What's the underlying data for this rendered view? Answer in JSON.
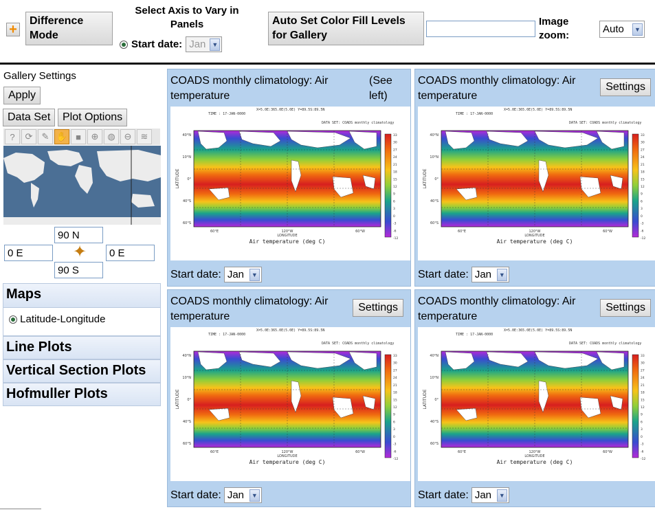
{
  "toolbar": {
    "plus_icon": "plus-icon",
    "difference_mode": "Difference Mode",
    "axis_title": "Select Axis to Vary in Panels",
    "start_date_label": "Start date:",
    "start_date_value": "Jan",
    "auto_set_label": "Auto Set Color Fill Levels for Gallery",
    "auto_set_value": "",
    "image_zoom_label": "Image zoom:",
    "image_zoom_value": "Auto"
  },
  "sidebar": {
    "gallery_settings": "Gallery Settings",
    "apply": "Apply",
    "tabs": [
      "Data Set",
      "Plot Options"
    ],
    "tools": [
      "help-icon",
      "reset-icon",
      "pencil-icon",
      "hand-icon",
      "square-icon",
      "zoom-in-icon",
      "globe-icon",
      "zoom-out-icon",
      "layers-icon"
    ],
    "coords": {
      "north": "90 N",
      "south": "90 S",
      "west": "0 E",
      "east": "0 E"
    },
    "sections": {
      "maps": "Maps",
      "maps_option": "Latitude-Longitude",
      "line_plots": "Line Plots",
      "vertical_section_plots": "Vertical Section Plots",
      "hofmuller_plots": "Hofmuller Plots"
    }
  },
  "panels": [
    {
      "title": "COADS monthly climatology: Air temperature",
      "note": "(See left)",
      "settings": "",
      "date_label": "Start date:",
      "date_value": "Jan"
    },
    {
      "title": "COADS monthly climatology: Air temperature",
      "note": "",
      "settings": "Settings",
      "date_label": "Start date:",
      "date_value": "Jan"
    },
    {
      "title": "COADS monthly climatology: Air temperature",
      "note": "",
      "settings": "Settings",
      "date_label": "Start date:",
      "date_value": "Jan"
    },
    {
      "title": "COADS monthly climatology: Air temperature",
      "note": "",
      "settings": "Settings",
      "date_label": "Start date:",
      "date_value": "Jan"
    }
  ],
  "plot": {
    "header_left": "TIME : 17-JAN-0000",
    "header_center": "X=5.0E:365.0E(5.0E)  Y=89.5S:89.5N",
    "header_right": "DATA SET: COADS monthly climatology",
    "xlabel": "Air temperature (deg C)",
    "ylabel": "LATITUDE",
    "x_axis_label": "LONGITUDE",
    "lat_ticks": [
      "40°N",
      "10°N",
      "0°",
      "40°S",
      "60°S"
    ],
    "lon_ticks": [
      "60°E",
      "120°W",
      "60°W"
    ],
    "colorbar_ticks": [
      "33",
      "30",
      "27",
      "24",
      "21",
      "18",
      "15",
      "12",
      "9",
      "6",
      "3",
      "0",
      "-3",
      "-6",
      "-12"
    ],
    "colors": {
      "hot": "#d71f1f",
      "warm": "#f06a10",
      "mid": "#f7c31a",
      "cool": "#8fcf3a",
      "cold": "#1aa38b",
      "frozen": "#3a4bd1",
      "polar": "#b42ad8"
    }
  }
}
